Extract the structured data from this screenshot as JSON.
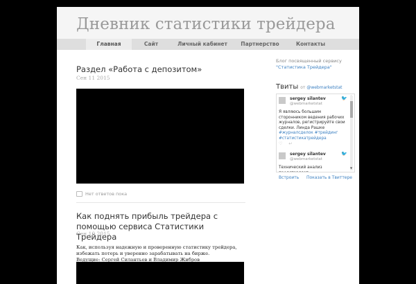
{
  "site": {
    "title": "Дневник статистики трейдера"
  },
  "nav": {
    "items": [
      {
        "label": "Главная",
        "active": true
      },
      {
        "label": "Сайт",
        "active": false
      },
      {
        "label": "Личный кабинет",
        "active": false
      },
      {
        "label": "Партнерство",
        "active": false
      },
      {
        "label": "Контакты",
        "active": false
      }
    ]
  },
  "posts": [
    {
      "title": "Раздел «Работа с депозитом»",
      "date": "Сен 11 2015",
      "comments": "Нет ответов пока"
    },
    {
      "title": "Как поднять прибыль трейдера с помощью сервиса Статистики Трейдера",
      "date": "Сен 10 2015",
      "excerpt_line1": "Как, используя надежную и проверенную статистику трейдера, избежать потерь и уверенно зарабатывать на бирже.",
      "excerpt_line2": "Ведущие: Сергей Силантьев и Владимир Жибров"
    }
  ],
  "sidebar": {
    "blurb": "Блог посвященный сервису",
    "blurb_link": "\"Статистика Трейдера\"",
    "twitter": {
      "title": "Твиты",
      "from_label": "от",
      "from_handle": "@webmarketstat",
      "tweets": [
        {
          "name": "sergey silantev",
          "handle": "@webmarketstat",
          "text": "Я являюсь большим сторонником ведения рабочих журналов, регистрируйте свои сделки. Линда Рашке",
          "tags": "#журналсделок #трейдинг #статистикатрейдера"
        },
        {
          "name": "sergey silantev",
          "handle": "@webmarketstat",
          "text": "Технический анализ представляет"
        }
      ],
      "embed_label": "Встроить",
      "view_label": "Показать в Твиттере"
    }
  }
}
